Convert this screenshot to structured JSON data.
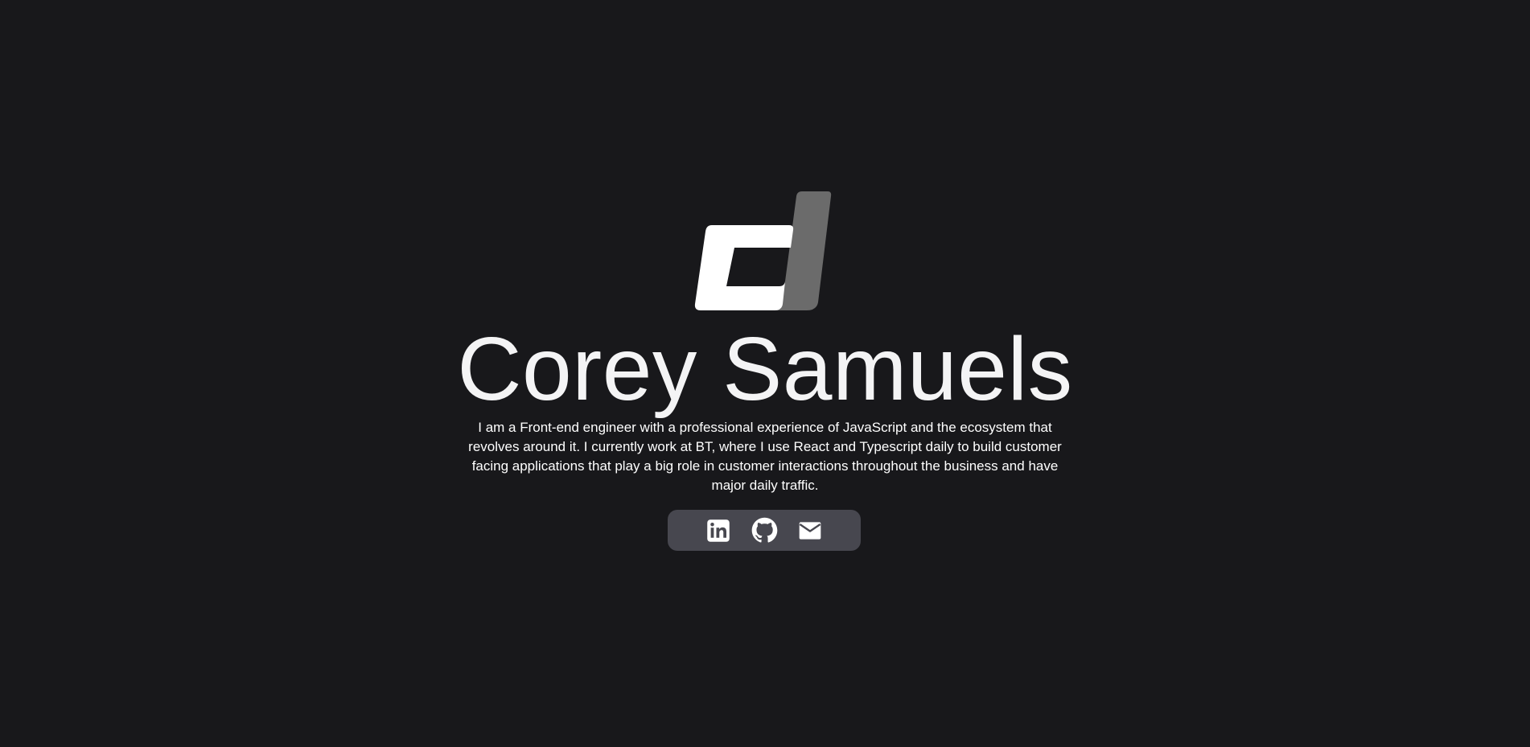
{
  "hero": {
    "logo_icon": "cj-logo",
    "name": "Corey Samuels",
    "bio": "I am a Front-end engineer with a professional experience of JavaScript and the ecosystem that revolves around it. I currently work at BT, where I use React and Typescript daily to build customer facing applications that play a big role in customer interactions throughout the business and have major daily traffic."
  },
  "socials": [
    {
      "icon": "linkedin-icon"
    },
    {
      "icon": "github-icon"
    },
    {
      "icon": "mail-icon"
    }
  ],
  "colors": {
    "background": "#18181b",
    "text": "#f4f4f5",
    "logo_primary": "#ffffff",
    "logo_secondary": "#6b6b6b",
    "social_bar": "#47474f"
  }
}
